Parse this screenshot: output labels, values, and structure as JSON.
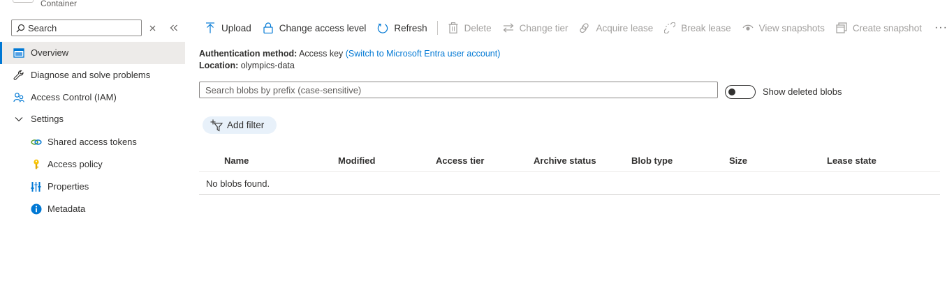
{
  "header": {
    "subtitle": "Container"
  },
  "sidebar": {
    "search_placeholder": "Search",
    "items": [
      {
        "label": "Overview",
        "icon": "overview-icon",
        "selected": true
      },
      {
        "label": "Diagnose and solve problems",
        "icon": "wrench-icon"
      },
      {
        "label": "Access Control (IAM)",
        "icon": "people-icon"
      },
      {
        "label": "Settings",
        "icon": "chevron-down-icon",
        "expanded": true
      },
      {
        "label": "Shared access tokens",
        "icon": "link-icon"
      },
      {
        "label": "Access policy",
        "icon": "key-icon"
      },
      {
        "label": "Properties",
        "icon": "properties-icon"
      },
      {
        "label": "Metadata",
        "icon": "info-icon"
      }
    ]
  },
  "toolbar": {
    "upload": "Upload",
    "change_access_level": "Change access level",
    "refresh": "Refresh",
    "delete": "Delete",
    "change_tier": "Change tier",
    "acquire_lease": "Acquire lease",
    "break_lease": "Break lease",
    "view_snapshots": "View snapshots",
    "create_snapshot": "Create snapshot",
    "more": "···"
  },
  "info": {
    "auth_label": "Authentication method:",
    "auth_value": "Access key",
    "auth_link": "(Switch to Microsoft Entra user account)",
    "location_label": "Location:",
    "location_value": "olympics-data"
  },
  "blob_search": {
    "placeholder": "Search blobs by prefix (case-sensitive)"
  },
  "show_deleted": {
    "label": "Show deleted blobs",
    "on": false
  },
  "filter": {
    "label": "Add filter"
  },
  "table": {
    "columns": [
      "Name",
      "Modified",
      "Access tier",
      "Archive status",
      "Blob type",
      "Size",
      "Lease state"
    ],
    "empty_message": "No blobs found."
  },
  "colors": {
    "accent": "#0078d4",
    "selected_bg": "#edebe9",
    "pill_bg": "#e8f1fa"
  }
}
